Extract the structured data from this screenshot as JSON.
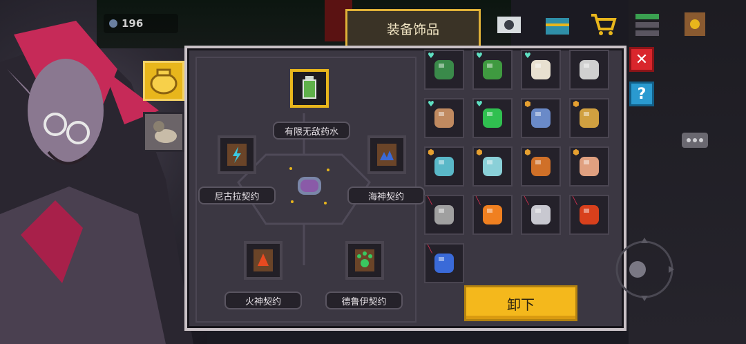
{
  "currency": {
    "value": "196"
  },
  "header": {
    "tab_title": "装备饰品"
  },
  "slots": {
    "top": {
      "label": "有限无敌药水"
    },
    "left": {
      "label": "尼古拉契约"
    },
    "right": {
      "label": "海神契约"
    },
    "bottom_left": {
      "label": "火神契约"
    },
    "bottom_right": {
      "label": "德鲁伊契约"
    }
  },
  "actions": {
    "unequip_label": "卸下"
  },
  "inventory": [
    {
      "icon": "green-blob-item-icon",
      "color": "#3a8a4a",
      "badge": "heart"
    },
    {
      "icon": "vine-item-icon",
      "color": "#3f9a40",
      "badge": "heart"
    },
    {
      "icon": "bone-item-icon",
      "color": "#e8e0d0",
      "badge": "heart"
    },
    {
      "icon": "helmet-item-icon",
      "color": "#d0d0d0",
      "badge": "none"
    },
    {
      "icon": "glasses-face-item-icon",
      "color": "#c08a60",
      "badge": "heart"
    },
    {
      "icon": "green-x-item-icon",
      "color": "#30c050",
      "badge": "heart"
    },
    {
      "icon": "blue-cloak-item-icon",
      "color": "#6a8ac8",
      "badge": "shield"
    },
    {
      "icon": "gold-cape-item-icon",
      "color": "#d0a040",
      "badge": "shield"
    },
    {
      "icon": "ice-boot-item-icon",
      "color": "#5ab8c8",
      "badge": "shield"
    },
    {
      "icon": "ice-shard-item-icon",
      "color": "#8ad0d8",
      "badge": "shield"
    },
    {
      "icon": "fire-boots-item-icon",
      "color": "#d07028",
      "badge": "shield"
    },
    {
      "icon": "meat-item-icon",
      "color": "#e0a080",
      "badge": "shield"
    },
    {
      "icon": "gauntlet-item-icon",
      "color": "#a0a0a0",
      "badge": "red"
    },
    {
      "icon": "fire-crystal-item-icon",
      "color": "#f08020",
      "badge": "red"
    },
    {
      "icon": "silver-shard-item-icon",
      "color": "#c8c8d0",
      "badge": "red"
    },
    {
      "icon": "target-item-icon",
      "color": "#d8401c",
      "badge": "red"
    },
    {
      "icon": "blue-gem-item-icon",
      "color": "#3a6ad8",
      "badge": "red"
    }
  ]
}
